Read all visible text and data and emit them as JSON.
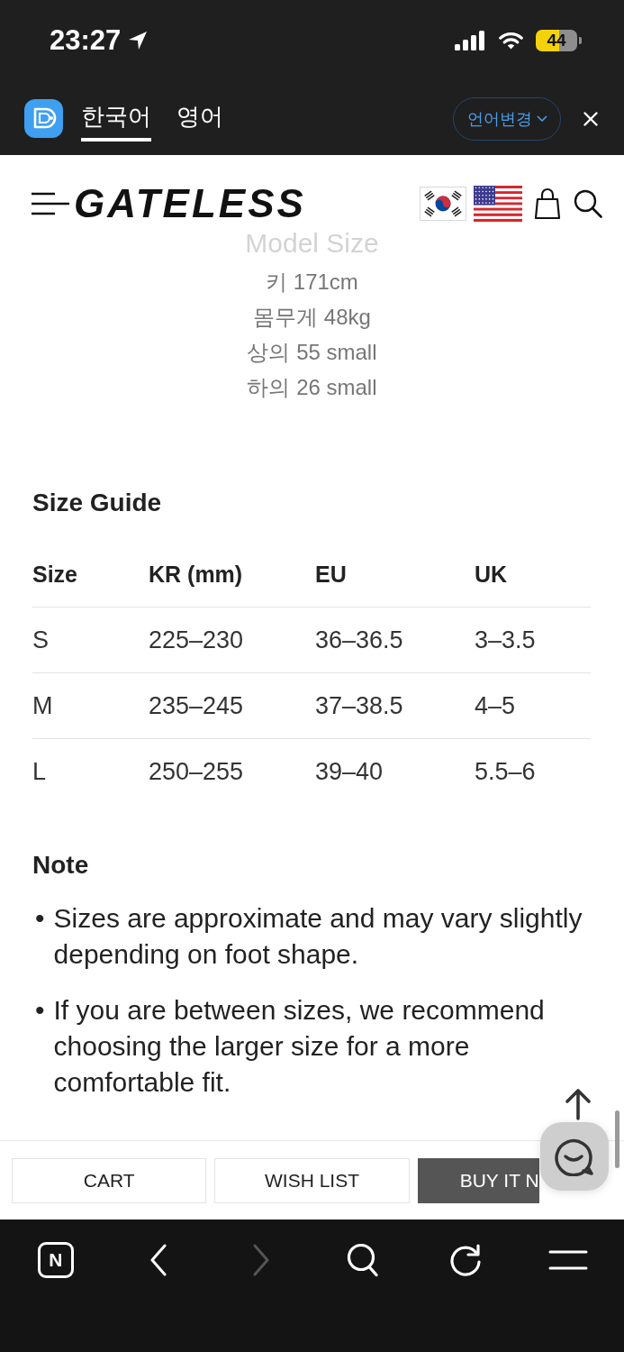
{
  "status_bar": {
    "time": "23:27",
    "battery": "44"
  },
  "translation_bar": {
    "tabs": [
      {
        "label": "한국어",
        "selected": true
      },
      {
        "label": "영어",
        "selected": false
      }
    ],
    "language_button": "언어변경"
  },
  "header": {
    "logo": "GATELESS"
  },
  "model_size": {
    "title": "Model Size",
    "lines": [
      "키 171cm",
      "몸무게 48kg",
      "상의 55 small",
      "하의 26 small"
    ]
  },
  "size_guide": {
    "title": "Size Guide",
    "columns": [
      "Size",
      "KR (mm)",
      "EU",
      "UK"
    ],
    "rows": [
      [
        "S",
        "225–230",
        "36–36.5",
        "3–3.5"
      ],
      [
        "M",
        "235–245",
        "37–38.5",
        "4–5"
      ],
      [
        "L",
        "250–255",
        "39–40",
        "5.5–6"
      ]
    ]
  },
  "note": {
    "title": "Note",
    "items": [
      {
        "bullet": "•",
        "text": "Sizes are approximate and may vary slightly depending on foot shape."
      },
      {
        "bullet": "•",
        "text": "If you are between sizes, we recommend choosing the larger size for a more comfortable fit."
      }
    ]
  },
  "action_bar": {
    "buttons": [
      {
        "label": "CART",
        "kind": "outline"
      },
      {
        "label": "WISH LIST",
        "kind": "outline"
      },
      {
        "label": "BUY IT N",
        "kind": "filled"
      }
    ]
  },
  "browser_toolbar": {
    "logo": "N",
    "back": {
      "disabled": false
    },
    "forward": {
      "disabled": true
    }
  }
}
